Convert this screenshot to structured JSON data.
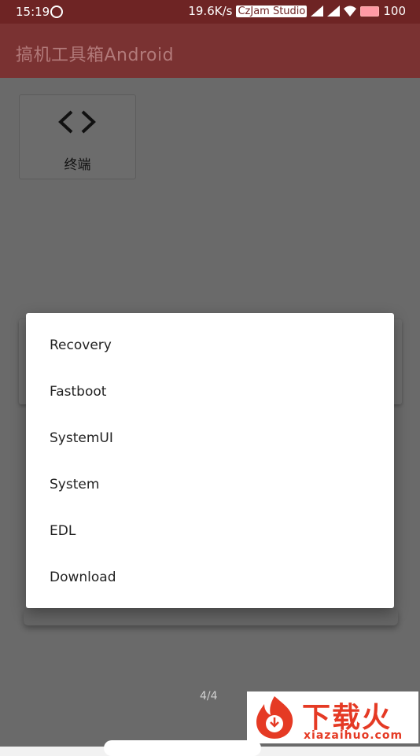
{
  "status_bar": {
    "time": "15:19",
    "net_speed": "19.6K/s",
    "carrier": "CzJam Studio",
    "battery": "100"
  },
  "app_bar": {
    "title": "搞机工具箱Android"
  },
  "tiles": [
    {
      "label": "终端",
      "icon": "code-brackets-icon"
    }
  ],
  "dialog": {
    "items": [
      "Recovery",
      "Fastboot",
      "SystemUI",
      "System",
      "EDL",
      "Download"
    ]
  },
  "pager": {
    "text": "4/4"
  },
  "watermark": {
    "title": "下载火",
    "subtitle": "xiazaihuo.com"
  },
  "colors": {
    "status_bar": "#6e2424",
    "app_bar": "#7a3232",
    "scrim": "#6a6a6a",
    "brand_red": "#e53a24"
  }
}
